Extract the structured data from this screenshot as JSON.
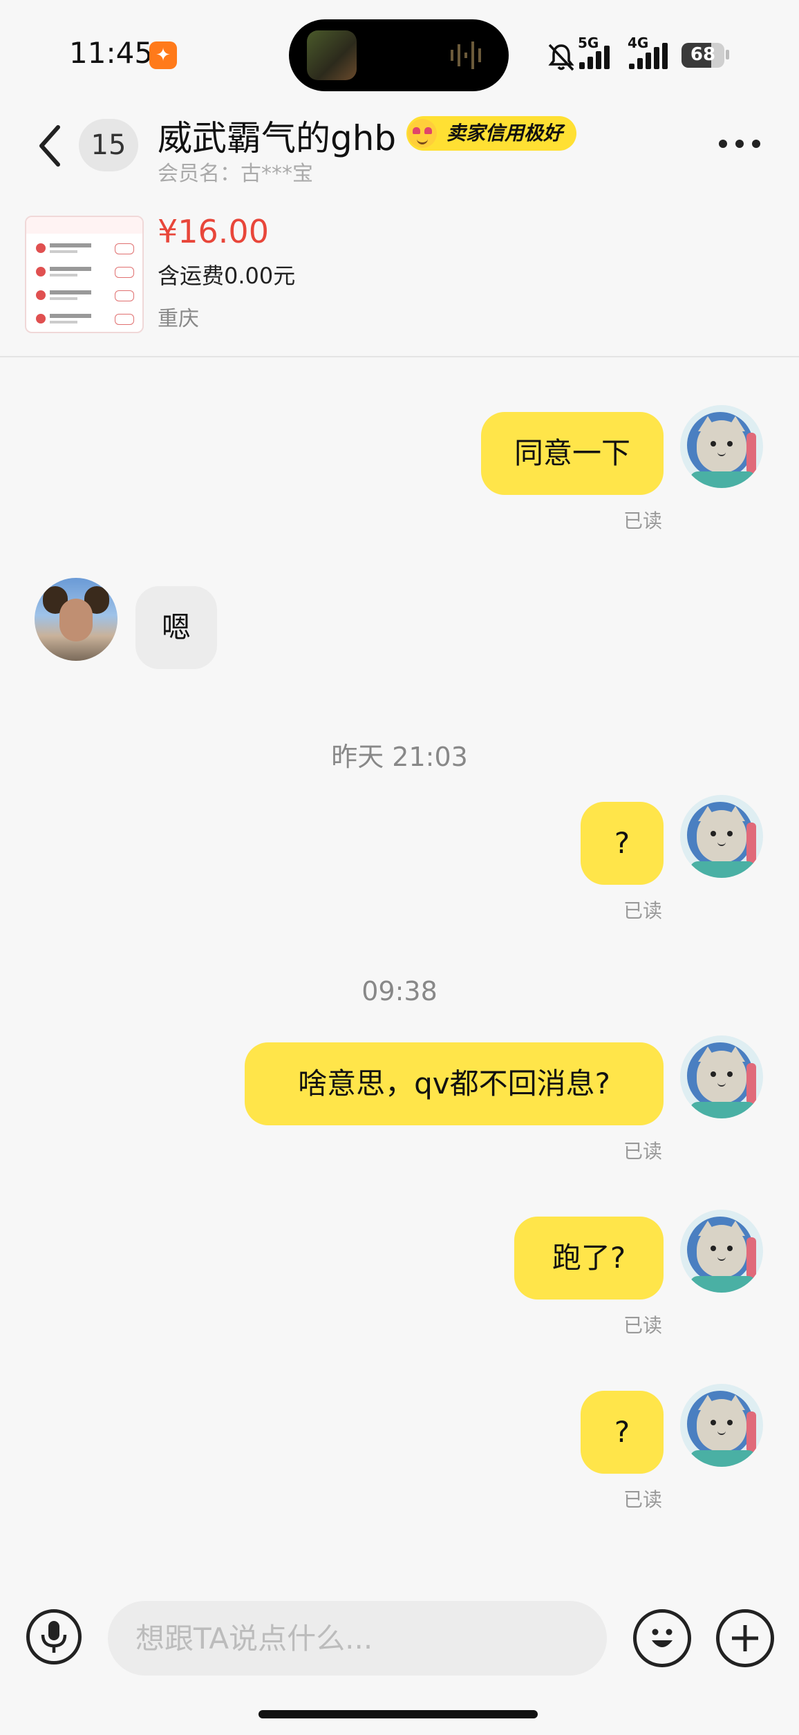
{
  "status_bar": {
    "time": "11:45",
    "network_1": "5G",
    "network_2": "4G",
    "battery": "68"
  },
  "header": {
    "unread_count": "15",
    "seller_name": "威武霸气的ghb",
    "credit_badge": "卖家信用极好",
    "member_label": "会员名：古***宝"
  },
  "product": {
    "price": "¥16.00",
    "shipping": "含运费0.00元",
    "location": "重庆"
  },
  "messages": [
    {
      "text": "同意一下",
      "status": "已读"
    },
    {
      "text": "嗯"
    },
    {
      "text": "?",
      "status": "已读"
    },
    {
      "text": "啥意思，qv都不回消息?",
      "status": "已读"
    },
    {
      "text": "跑了?",
      "status": "已读"
    },
    {
      "text": "?",
      "status": "已读"
    }
  ],
  "timestamps": [
    "昨天 21:03",
    "09:38"
  ],
  "input": {
    "placeholder": "想跟TA说点什么..."
  },
  "colors": {
    "my_bubble": "#ffe54a",
    "their_bubble": "#ececec",
    "price": "#e8463a",
    "credit_badge": "#ffe033"
  }
}
